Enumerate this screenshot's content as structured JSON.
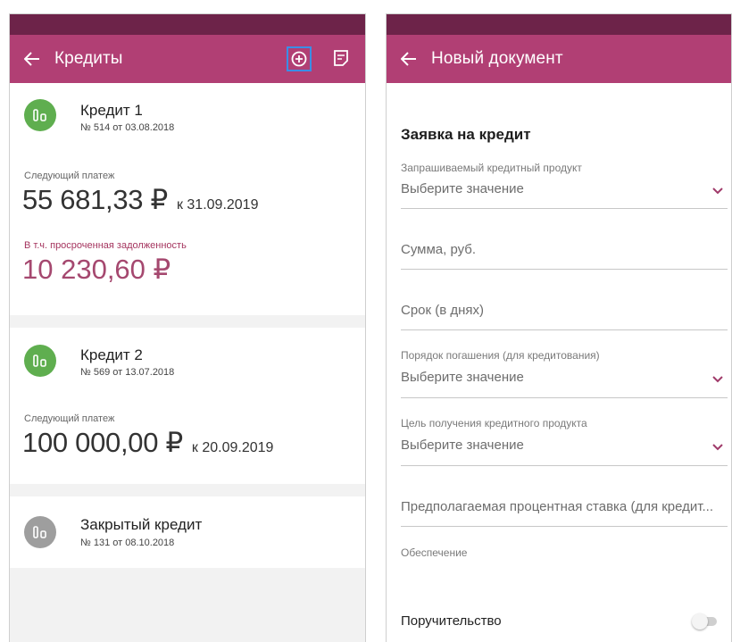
{
  "colors": {
    "status_bar": "#6d2349",
    "app_bar": "#b13f74",
    "active_loan_icon": "#5fae4f",
    "closed_loan_icon": "#9e9e9e",
    "overdue_text": "#a5486f",
    "highlight_border": "#3a8ee6"
  },
  "left": {
    "header": {
      "title": "Кредиты",
      "back_icon": "arrow-left-icon",
      "add_icon": "plus-circle-icon",
      "doc_icon": "document-icon"
    },
    "loans": [
      {
        "title": "Кредит 1",
        "subtitle": "№ 514 от 03.08.2018",
        "next_payment_label": "Следующий платеж",
        "amount": "55 681,33 ₽",
        "due": "к 31.09.2019",
        "overdue_label": "В т.ч. просроченная задолженность",
        "overdue_amount": "10 230,60 ₽",
        "status": "active"
      },
      {
        "title": "Кредит 2",
        "subtitle": "№ 569 от 13.07.2018",
        "next_payment_label": "Следующий платеж",
        "amount": "100 000,00 ₽",
        "due": "к 20.09.2019",
        "status": "active"
      },
      {
        "title": "Закрытый кредит",
        "subtitle": "№ 131 от 08.10.2018",
        "status": "closed"
      }
    ]
  },
  "right": {
    "header": {
      "title": "Новый документ",
      "back_icon": "arrow-left-icon"
    },
    "form": {
      "title": "Заявка на кредит",
      "fields": [
        {
          "label": "Запрашиваемый кредитный продукт",
          "value": "Выберите значение",
          "type": "select"
        },
        {
          "placeholder": "Сумма, руб.",
          "type": "input"
        },
        {
          "placeholder": "Срок (в днях)",
          "type": "input"
        },
        {
          "label": "Порядок погашения (для кредитования)",
          "value": "Выберите значение",
          "type": "select"
        },
        {
          "label": "Цель получения кредитного продукта",
          "value": "Выберите значение",
          "type": "select"
        },
        {
          "placeholder": "Предполагаемая процентная ставка (для кредит...",
          "type": "input"
        }
      ],
      "collateral_label": "Обеспечение",
      "guarantee_label": "Поручительство",
      "guarantee_enabled": false
    }
  }
}
